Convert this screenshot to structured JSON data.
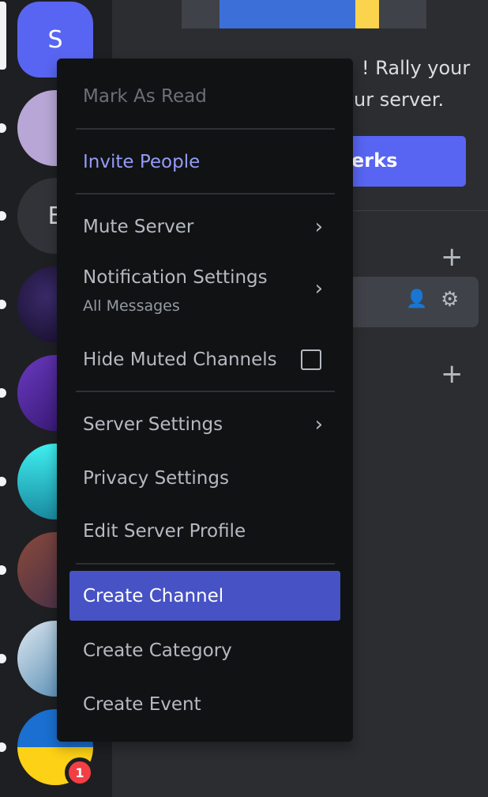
{
  "rail": {
    "servers": [
      {
        "initial": "S",
        "color": "#5865f2",
        "selected": true
      },
      {
        "initial": "",
        "color": "#b8a6d6"
      },
      {
        "initial": "E",
        "color": "#313338"
      },
      {
        "initial": "",
        "color": "#1a1030"
      },
      {
        "initial": "",
        "color": "#4b2a8a"
      },
      {
        "initial": "",
        "color": "#2bc9d6"
      },
      {
        "initial": "",
        "color": "#6b3a3a"
      },
      {
        "initial": "",
        "color": "#4a7aa0"
      },
      {
        "initial": "",
        "color": "#1a6fd0"
      }
    ],
    "badge": "1"
  },
  "main": {
    "promo_line1": "! Rally your",
    "promo_line2": "ur server.",
    "perks_button": "erks"
  },
  "menu": {
    "mark_as_read": "Mark As Read",
    "invite_people": "Invite People",
    "mute_server": "Mute Server",
    "notification_settings": "Notification Settings",
    "notification_value": "All Messages",
    "hide_muted": "Hide Muted Channels",
    "hide_muted_checked": false,
    "server_settings": "Server Settings",
    "privacy_settings": "Privacy Settings",
    "edit_profile": "Edit Server Profile",
    "create_channel": "Create Channel",
    "create_category": "Create Category",
    "create_event": "Create Event"
  },
  "colors": {
    "accent": "#5865f2",
    "highlight": "#4752c4",
    "invite": "#949cf7"
  }
}
